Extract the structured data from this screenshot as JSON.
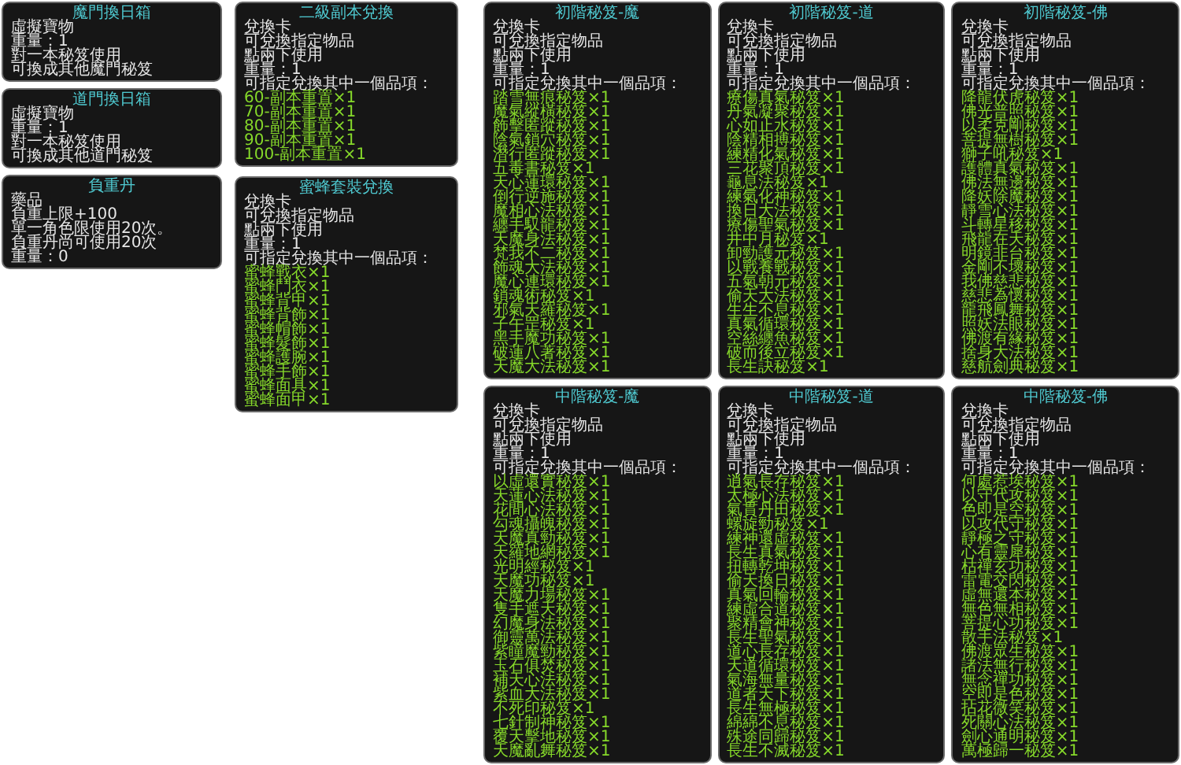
{
  "left_panels": [
    {
      "title": "魔門換日箱",
      "lines": [
        "虛擬寶物",
        "重量：1",
        "對一本秘笈使用",
        "可換成其他魔門秘笈"
      ]
    },
    {
      "title": "道門換日箱",
      "lines": [
        "虛擬寶物",
        "重量：1",
        "對一本秘笈使用",
        "可換成其他道門秘笈"
      ]
    },
    {
      "title": "負重丹",
      "lines": [
        "藥品",
        "負重上限+100",
        "單一角色限使用20次。",
        "負重丹尚可使用20次",
        "重量：0"
      ]
    }
  ],
  "middle_panels": [
    {
      "title": "二級副本兌換",
      "lines": [
        "兌換卡",
        "可兌換指定物品",
        "點兩下使用",
        "重量：1",
        "可指定兌換其中一個品項："
      ],
      "options": [
        "60-副本重置×1",
        "70-副本重置×1",
        "80-副本重置×1",
        "90-副本重置×1",
        "100-副本重置×1"
      ]
    },
    {
      "title": "蜜蜂套裝兌換",
      "lines": [
        "兌換卡",
        "可兌換指定物品",
        "點兩下使用",
        "重量：1",
        "可指定兌換其中一個品項："
      ],
      "options": [
        "蜜蜂戰衣×1",
        "蜜蜂鬥衣×1",
        "蜜蜂背甲×1",
        "蜜蜂背飾×1",
        "蜜蜂帽飾×1",
        "蜜蜂髮飾×1",
        "蜜蜂護腕×1",
        "蜜蜂手飾×1",
        "蜜蜂面具×1",
        "蜜蜂面甲×1"
      ]
    }
  ],
  "grid_panels": [
    {
      "title": "初階秘笈-魔",
      "lines": [
        "兌換卡",
        "可兌換指定物品",
        "點兩下使用",
        "重量：1",
        "可指定兌換其中一個品項："
      ],
      "options": [
        "踏雪無痕秘笈×1",
        "魔氣縱橫秘笈×1",
        "飾擊匿蹤秘笈×1",
        "陰氣鎖穴秘笈×1",
        "潛行匿蹤秘笈×1",
        "五毒書秘笈×1",
        "天心蓮環秘笈×1",
        "倒行逆施秘笈×1",
        "魔相心法秘笈×1",
        "纏手馭龍秘笈×1",
        "天魔身法秘笈×1",
        "梵我不二秘笈×1",
        "飾魂大法秘笈×1",
        "魔心連環秘笈×1",
        "鎖魂術秘笈×1",
        "邪氣天羅秘笈×1",
        "子午罡秘笈×1",
        "黑手魔功秘笈×1",
        "破蓮八著秘笈×1",
        "天魔大法秘笈×1"
      ]
    },
    {
      "title": "初階秘笈-道",
      "lines": [
        "兌換卡",
        "可兌換指定物品",
        "點兩下使用",
        "重量：1",
        "可指定兌換其中一個品項："
      ],
      "options": [
        "療傷真氣秘笈×1",
        "丹氣凝聚秘笈×1",
        "心如止水秘笈×1",
        "陰精相搏秘笈×1",
        "練精化氣秘笈×1",
        "三花聚頂秘笈×1",
        "龜息法秘笈×1",
        "練氣化神秘笈×1",
        "換日大法秘笈×1",
        "療傷聖氣秘笈×1",
        "井中月秘笈×1",
        "卸勁護元秘笈×1",
        "以戰養戰秘笈×1",
        "五氣朝元秘笈×1",
        "偷天大法秘笈×1",
        "生生不息秘笈×1",
        "真氣循環秘笈×1",
        "空絲纏魚秘笈×1",
        "破而後立秘笈×1",
        "長生訣秘笈×1"
      ]
    },
    {
      "title": "初階秘笈-佛",
      "lines": [
        "兌換卡",
        "可兌換指定物品",
        "點兩下使用",
        "重量：1",
        "可指定兌換其中一個品項："
      ],
      "options": [
        "降龍伏虎秘笈×1",
        "佛光普照秘笈×1",
        "以柔克剛秘笈×1",
        "菩提無樹秘笈×1",
        "獅子吼秘笈×1",
        "護體真氣秘笈×1",
        "佛法無邊秘笈×1",
        "降妖除魔秘笈×1",
        "靜雪心法秘笈×1",
        "斗轉星移秘笈×1",
        "飛龍在天秘笈×1",
        "明鏡非台秘笈×1",
        "金剛不壞秘笈×1",
        "我佛慈悲秘笈×1",
        "慈悲為懷秘笈×1",
        "龍飛鳳舞秘笈×1",
        "照妖法眼秘笈×1",
        "佛渡有緣秘笈×1",
        "捨身大法秘笈×1",
        "慈航劍典秘笈×1"
      ]
    },
    {
      "title": "中階秘笈-魔",
      "lines": [
        "兌換卡",
        "可兌換指定物品",
        "點兩下使用",
        "重量：1",
        "可指定兌換其中一個品項："
      ],
      "options": [
        "以虛還實秘笈×1",
        "天蓮心法秘笈×1",
        "花間心法秘笈×1",
        "勾魂攝魄秘笈×1",
        "天魔真勁秘笈×1",
        "天羅地網秘笈×1",
        "光明經秘笈×1",
        "天魔功秘笈×1",
        "天魔力場秘笈×1",
        "隻手遮天秘笈×1",
        "幻魔身法秘笈×1",
        "御靈萬法秘笈×1",
        "紫瞳魔勁秘笈×1",
        "玉石俱焚秘笈×1",
        "補天心法秘笈×1",
        "紫血大法秘笈×1",
        "不死印秘笈×1",
        "七針制神秘笈×1",
        "覆天擊地秘笈×1",
        "天魔亂舞秘笈×1"
      ]
    },
    {
      "title": "中階秘笈-道",
      "lines": [
        "兌換卡",
        "可兌換指定物品",
        "點兩下使用",
        "重量：1",
        "可指定兌換其中一個品項："
      ],
      "options": [
        "逍氣長存秘笈×1",
        "太極心法秘笈×1",
        "氣貫丹田秘笈×1",
        "螺旋勁秘笈×1",
        "練神還虛秘笈×1",
        "長生真氣秘笈×1",
        "扭轉乾坤秘笈×1",
        "偷天換日秘笈×1",
        "真氣回輪秘笈×1",
        "練虛合道秘笈×1",
        "聚精會神秘笈×1",
        "長生聖氣秘笈×1",
        "道心長存秘笈×1",
        "天道循環秘笈×1",
        "氣海無量秘笈×1",
        "道者天下秘笈×1",
        "長生無極秘笈×1",
        "綿綿不息秘笈×1",
        "殊途同歸秘笈×1",
        "長生不滅秘笈×1"
      ]
    },
    {
      "title": "中階秘笈-佛",
      "lines": [
        "兌換卡",
        "可兌換指定物品",
        "點兩下使用",
        "重量：1",
        "可指定兌換其中一個品項："
      ],
      "options": [
        "何處惹埃秘笈×1",
        "以守代攻秘笈×1",
        "色即是空秘笈×1",
        "以攻代守秘笈×1",
        "靜極之守秘笈×1",
        "心有靈犀秘笈×1",
        "枯禪玄功秘笈×1",
        "雷電交閃秘笈×1",
        "虛無還本秘笈×1",
        "無色無相秘笈×1",
        "菩提心功秘笈×1",
        "散手法秘笈×1",
        "佛渡眾生秘笈×1",
        "諸法無行秘笈×1",
        "無念禪功秘笈×1",
        "空即是色秘笈×1",
        "拈花微笑秘笈×1",
        "死關心法秘笈×1",
        "劍心通明秘笈×1",
        "萬極歸一秘笈×1"
      ]
    }
  ]
}
